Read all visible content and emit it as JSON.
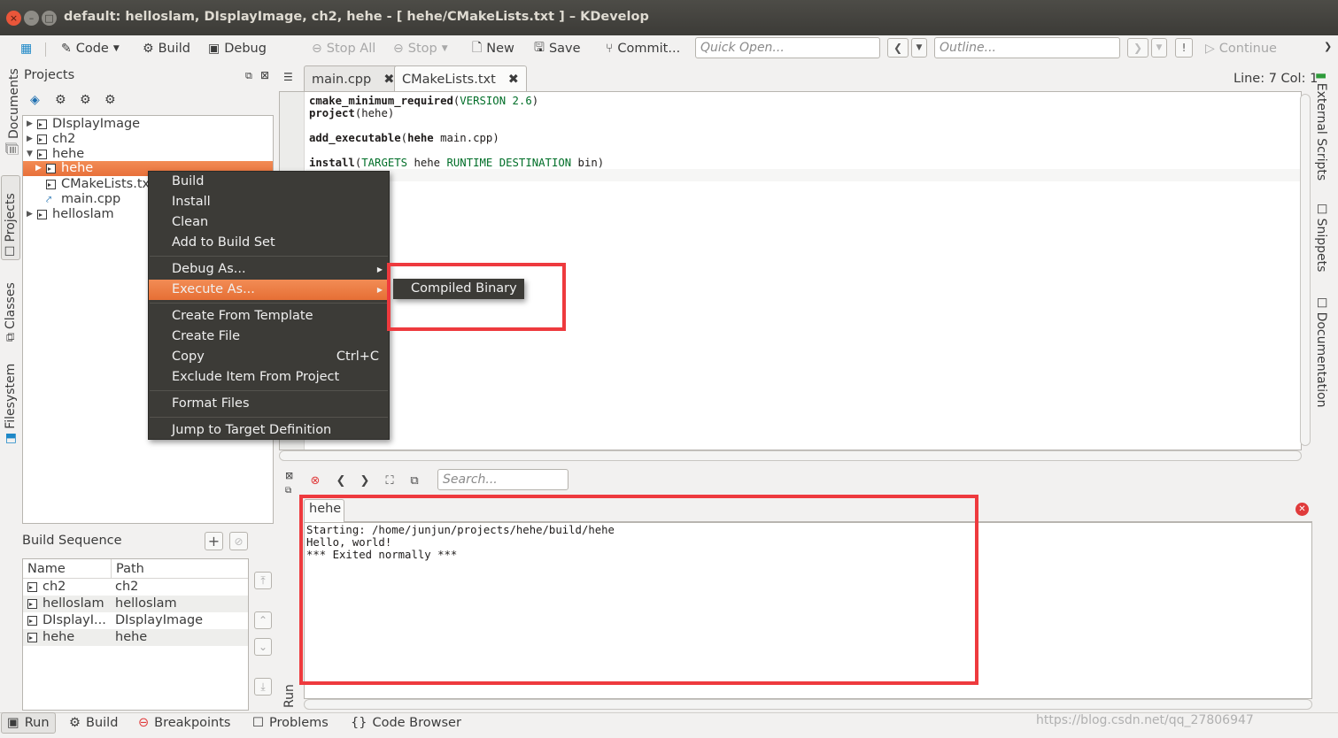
{
  "window": {
    "title": "default:  helloslam, DIsplayImage, ch2, hehe - [ hehe/CMakeLists.txt ] – KDevelop",
    "close_glyph": "×",
    "min_glyph": "–",
    "max_glyph": "□"
  },
  "toolbar": {
    "code": "Code",
    "build": "Build",
    "debug": "Debug",
    "stop_all": "Stop All",
    "stop": "Stop",
    "new": "New",
    "save": "Save",
    "commit": "Commit...",
    "quick_open_placeholder": "Quick Open...",
    "outline_placeholder": "Outline...",
    "continue": "Continue"
  },
  "left_tabs": {
    "documents": "Documents",
    "projects": "Projects",
    "classes": "Classes",
    "filesystem": "Filesystem"
  },
  "right_tabs": {
    "external_scripts": "External Scripts",
    "snippets": "Snippets",
    "documentation": "Documentation"
  },
  "projects": {
    "title": "Projects",
    "tree": {
      "displayimage": "DIsplayImage",
      "ch2": "ch2",
      "hehe": "hehe",
      "hehe_target": "hehe",
      "cmakelists": "CMakeLists.txt",
      "maincpp": "main.cpp",
      "helloslam": "helloslam"
    }
  },
  "context_menu": {
    "build": "Build",
    "install": "Install",
    "clean": "Clean",
    "add_to_build_set": "Add to Build Set",
    "debug_as": "Debug As...",
    "execute_as": "Execute As...",
    "create_from_template": "Create From Template",
    "create_file": "Create File",
    "copy": "Copy",
    "copy_shortcut": "Ctrl+C",
    "exclude_item": "Exclude Item From Project",
    "format_files": "Format Files",
    "jump_to_target": "Jump to Target Definition"
  },
  "submenu": {
    "compiled_binary": "Compiled Binary"
  },
  "editor": {
    "tabs": {
      "main_cpp": "main.cpp",
      "cmakelists": "CMakeLists.txt"
    },
    "line_col": "Line: 7 Col: 1",
    "code": {
      "l1_fn": "cmake_minimum_required",
      "l1_open": "(",
      "l1_arg": "VERSION 2.6",
      "l1_close": ")",
      "l2_fn": "project",
      "l2_args": "(hehe)",
      "l4_fn": "add_executable",
      "l4_open": "(",
      "l4_arg": "hehe",
      "l4_rest": " main.cpp)",
      "l6_fn": "install",
      "l6_open": "(",
      "l6_kw1": "TARGETS",
      "l6_mid": " hehe ",
      "l6_kw2": "RUNTIME DESTINATION",
      "l6_end": " bin)"
    }
  },
  "build_sequence": {
    "title": "Build Sequence",
    "col_name": "Name",
    "col_path": "Path",
    "rows": [
      {
        "name": "ch2",
        "path": "ch2"
      },
      {
        "name": "helloslam",
        "path": "helloslam"
      },
      {
        "name": "DIsplayI...",
        "path": "DIsplayImage"
      },
      {
        "name": "hehe",
        "path": "hehe"
      }
    ]
  },
  "run_panel": {
    "search_placeholder": "Search...",
    "tab": "hehe",
    "vertical_label": "Run",
    "output": [
      "Starting: /home/junjun/projects/hehe/build/hehe",
      "Hello, world!",
      "*** Exited normally ***"
    ]
  },
  "bottom_tabs": {
    "run": "Run",
    "build": "Build",
    "breakpoints": "Breakpoints",
    "problems": "Problems",
    "code_browser": "Code Browser"
  },
  "watermark": "https://blog.csdn.net/qq_27806947",
  "colors": {
    "accent": "#e8703a",
    "menu_bg": "#3c3b37",
    "highlight_box": "#ee3a3e"
  }
}
